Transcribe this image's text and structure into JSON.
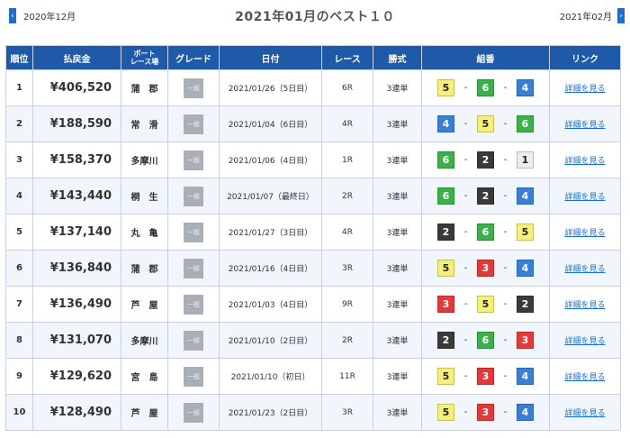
{
  "nav": {
    "prev": "2020年12月",
    "next": "2021年02月",
    "prev_arrow": "‹",
    "next_arrow": "›"
  },
  "title": "2021年01月のベスト１０",
  "headers": {
    "rank": "順位",
    "payout": "払戻金",
    "venue_line1": "ボート",
    "venue_line2": "レース場",
    "grade": "グレード",
    "date": "日付",
    "race": "レース",
    "ticket": "勝式",
    "combo": "組番",
    "link": "リンク"
  },
  "boat_colors": {
    "1": "#ededed",
    "2": "#3a3a3a",
    "3": "#e23a3a",
    "4": "#3a7fd6",
    "5": "#f5f07a",
    "6": "#3cb14b"
  },
  "boat_text_colors": {
    "1": "#222222",
    "2": "#ffffff",
    "3": "#ffffff",
    "4": "#ffffff",
    "5": "#222222",
    "6": "#ffffff"
  },
  "rows": [
    {
      "rank": "1",
      "payout": "¥406,520",
      "venue": "蒲　郡",
      "grade": "一般",
      "date": "2021/01/26（5日目）",
      "race": "6R",
      "ticket": "3連単",
      "combo": [
        5,
        6,
        4
      ],
      "link": "詳細を見る"
    },
    {
      "rank": "2",
      "payout": "¥188,590",
      "venue": "常　滑",
      "grade": "一般",
      "date": "2021/01/04（6日目）",
      "race": "4R",
      "ticket": "3連単",
      "combo": [
        4,
        5,
        6
      ],
      "link": "詳細を見る"
    },
    {
      "rank": "3",
      "payout": "¥158,370",
      "venue": "多摩川",
      "grade": "一般",
      "date": "2021/01/06（4日目）",
      "race": "1R",
      "ticket": "3連単",
      "combo": [
        6,
        2,
        1
      ],
      "link": "詳細を見る"
    },
    {
      "rank": "4",
      "payout": "¥143,440",
      "venue": "桐　生",
      "grade": "一般",
      "date": "2021/01/07（最終日）",
      "race": "2R",
      "ticket": "3連単",
      "combo": [
        6,
        2,
        4
      ],
      "link": "詳細を見る"
    },
    {
      "rank": "5",
      "payout": "¥137,140",
      "venue": "丸　亀",
      "grade": "一般",
      "date": "2021/01/27（3日目）",
      "race": "4R",
      "ticket": "3連単",
      "combo": [
        2,
        6,
        5
      ],
      "link": "詳細を見る"
    },
    {
      "rank": "6",
      "payout": "¥136,840",
      "venue": "蒲　郡",
      "grade": "一般",
      "date": "2021/01/16（4日目）",
      "race": "3R",
      "ticket": "3連単",
      "combo": [
        5,
        3,
        4
      ],
      "link": "詳細を見る"
    },
    {
      "rank": "7",
      "payout": "¥136,490",
      "venue": "芦　屋",
      "grade": "一般",
      "date": "2021/01/03（4日目）",
      "race": "9R",
      "ticket": "3連単",
      "combo": [
        3,
        5,
        2
      ],
      "link": "詳細を見る"
    },
    {
      "rank": "8",
      "payout": "¥131,070",
      "venue": "多摩川",
      "grade": "一般",
      "date": "2021/01/10（2日目）",
      "race": "2R",
      "ticket": "3連単",
      "combo": [
        2,
        6,
        3
      ],
      "link": "詳細を見る"
    },
    {
      "rank": "9",
      "payout": "¥129,620",
      "venue": "宮　島",
      "grade": "一般",
      "date": "2021/01/10（初日）",
      "race": "11R",
      "ticket": "3連単",
      "combo": [
        5,
        3,
        4
      ],
      "link": "詳細を見る"
    },
    {
      "rank": "10",
      "payout": "¥128,490",
      "venue": "芦　屋",
      "grade": "一般",
      "date": "2021/01/23（2日目）",
      "race": "3R",
      "ticket": "3連単",
      "combo": [
        5,
        3,
        4
      ],
      "link": "詳細を見る"
    }
  ]
}
